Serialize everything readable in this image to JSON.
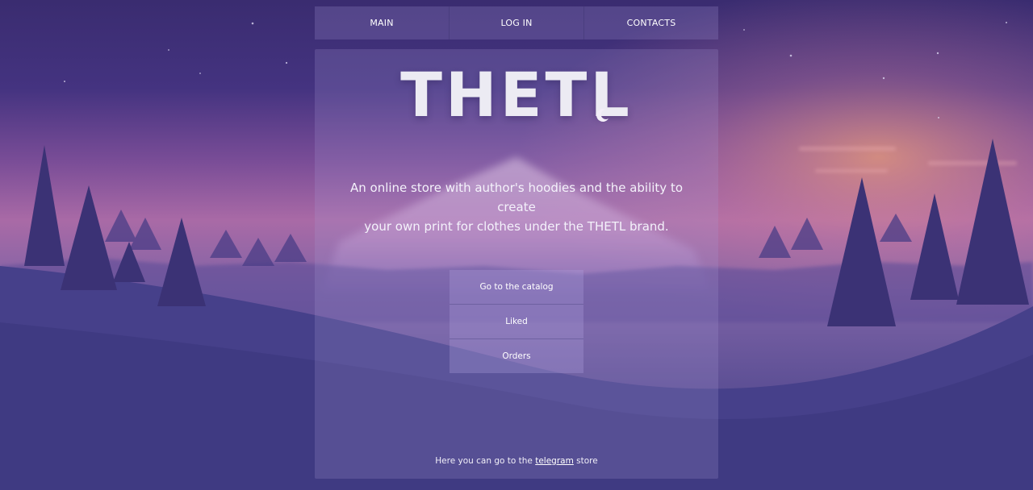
{
  "nav": {
    "items": [
      {
        "label": "MAIN"
      },
      {
        "label": "LOG IN"
      },
      {
        "label": "CONTACTS"
      }
    ]
  },
  "hero": {
    "logo": "THETL",
    "tagline_line1": "An online store with author's hoodies and the ability to create",
    "tagline_line2": "your own print for clothes under the THETL brand."
  },
  "menu": {
    "items": [
      {
        "label": "Go to the catalog"
      },
      {
        "label": "Liked"
      },
      {
        "label": "Orders"
      }
    ]
  },
  "footer": {
    "prefix": "Here you can go to the",
    "link": "telegram",
    "suffix": "store"
  },
  "colors": {
    "sky_top": "#3b2f73",
    "sky_glow": "#d97fa4",
    "ground": "#3d3a82",
    "trees": "#3a3373"
  }
}
